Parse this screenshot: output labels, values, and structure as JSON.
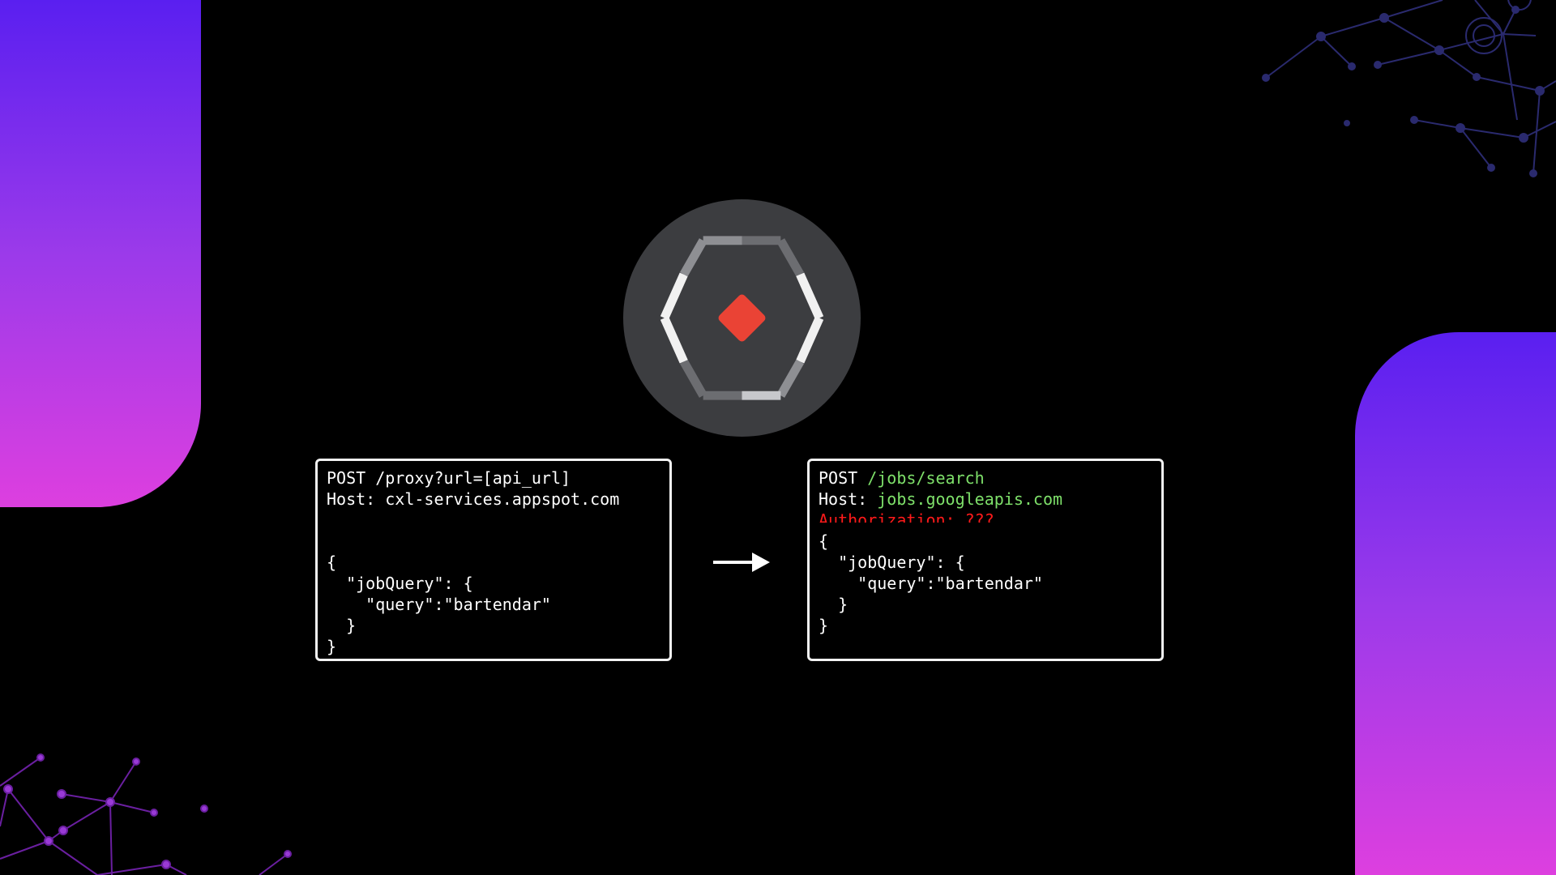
{
  "left_request": {
    "lines": [
      "POST /proxy?url=[api_url]",
      "Host: cxl-services.appspot.com",
      "",
      "",
      "{",
      "  \"jobQuery\": {",
      "    \"query\":\"bartendar\"",
      "  }",
      "}"
    ]
  },
  "right_request": {
    "method": "POST ",
    "path": "/jobs/search",
    "host_label": "Host: ",
    "host_value": "jobs.googleapis.com",
    "auth_line": "Authorization: ???",
    "body": [
      "{",
      "  \"jobQuery\": {",
      "    \"query\":\"bartendar\"",
      "  }",
      "}"
    ]
  },
  "colors": {
    "background": "#000000",
    "gradient_top": "#5a1ff0",
    "gradient_bottom": "#dd3fdf",
    "logo_circle": "#3c3d40",
    "logo_diamond": "#ea4335",
    "highlight_green": "#7ee06a",
    "highlight_red": "#ff1a1a"
  },
  "icons": {
    "logo": "api-gateway-hexagon-icon",
    "arrow": "arrow-right-icon"
  }
}
